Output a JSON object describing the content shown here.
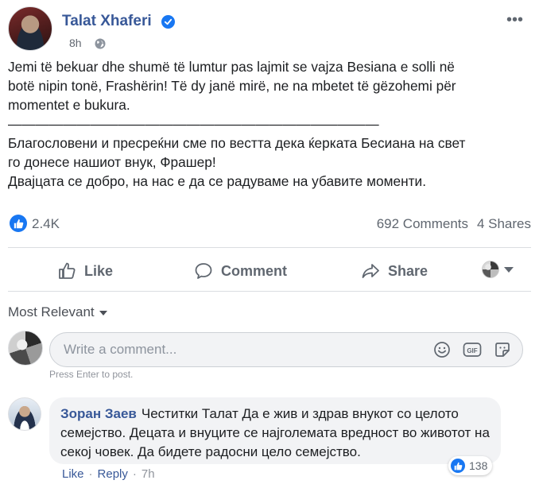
{
  "post": {
    "author_name": "Talat Xhaferi",
    "timestamp": "8h",
    "more_label": "•••",
    "body_lines": [
      "Jemi të bekuar dhe shumë të lumtur pas lajmit se vajza Besiana e solli në",
      "botë nipin tonë, Frashërin! Të dy janë mirë, ne na mbetet të gëzohemi për",
      "momentet e bukura.",
      "———————————————————————————",
      "Благословени и пресреќни сме по вестта дека ќерката Бесиана на свет",
      "го донесе нашиот внук, Фрашер!",
      "Двајцата се добро, на нас е да се радуваме на убавите моменти."
    ]
  },
  "stats": {
    "reaction_count": "2.4K",
    "comments_count": "692 Comments",
    "shares_count": "4 Shares"
  },
  "actions": {
    "like_label": "Like",
    "comment_label": "Comment",
    "share_label": "Share"
  },
  "comments_section": {
    "sort_label": "Most Relevant",
    "composer_placeholder": "Write a comment...",
    "press_enter_hint": "Press Enter to post.",
    "comments": [
      {
        "author": "Зоран Заев",
        "text": "Честитки Талат Да е жив и здрав внукот со целото семејство. Децата и внуците се најголемата вредност во животот на секој човек. Да бидете радосни цело семејство.",
        "reaction_count": "138",
        "like_label": "Like",
        "reply_label": "Reply",
        "time": "7h"
      }
    ]
  },
  "icons": {
    "verified": "verified-badge-icon",
    "globe": "globe-icon",
    "like": "thumbs-up-icon",
    "comment": "speech-bubble-icon",
    "share": "share-arrow-icon",
    "emoji": "smiley-icon",
    "gif": "gif-icon",
    "sticker": "sticker-icon"
  },
  "colors": {
    "link_blue": "#385898",
    "brand_blue": "#1877f2",
    "muted_text": "#606770",
    "bubble_bg": "#f2f3f5"
  }
}
